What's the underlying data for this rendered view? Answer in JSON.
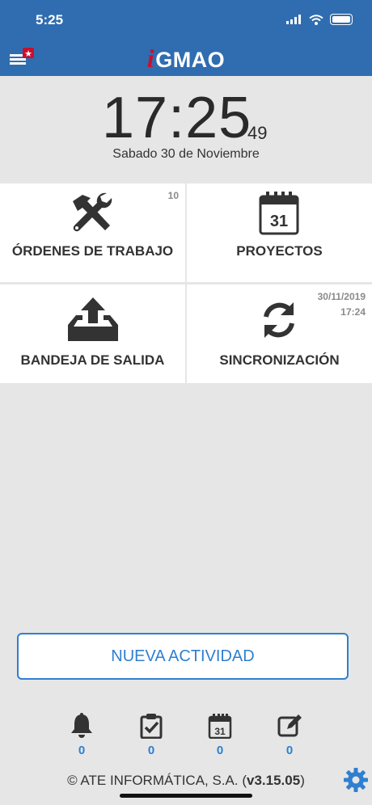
{
  "status_bar": {
    "time": "5:25"
  },
  "header": {
    "logo_prefix": "i",
    "logo_text": "GMAO"
  },
  "clock": {
    "hours_minutes": "17:25",
    "seconds": "49",
    "date": "Sabado 30 de Noviembre"
  },
  "tiles": [
    {
      "label": "ÓRDENES DE TRABAJO",
      "badge": "10",
      "icon": "tools-icon"
    },
    {
      "label": "PROYECTOS",
      "calendar_day": "31",
      "icon": "calendar-icon"
    },
    {
      "label": "BANDEJA DE SALIDA",
      "icon": "outbox-upload-icon"
    },
    {
      "label": "SINCRONIZACIÓN",
      "badge_date": "30/11/2019",
      "badge_time": "17:24",
      "icon": "sync-icon"
    }
  ],
  "nueva_actividad": "NUEVA ACTIVIDAD",
  "counters": [
    {
      "icon": "bell-icon",
      "value": "0"
    },
    {
      "icon": "clipboard-check-icon",
      "value": "0",
      "calendar_day": ""
    },
    {
      "icon": "calendar-small-icon",
      "value": "0",
      "calendar_day": "31"
    },
    {
      "icon": "edit-icon",
      "value": "0"
    }
  ],
  "footer": {
    "copyright": "© ATE INFORMÁTICA, S.A. (",
    "version": "v3.15.05",
    "close": ")"
  },
  "colors": {
    "brand_blue": "#2f6db0",
    "accent_blue": "#2f7fd0",
    "logo_red": "#c8102e"
  }
}
